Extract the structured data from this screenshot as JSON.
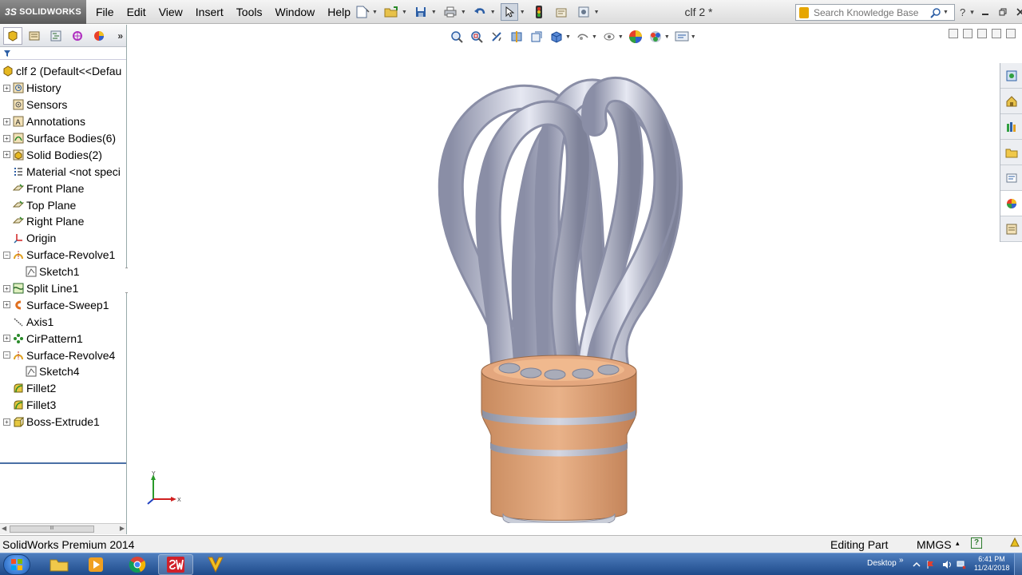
{
  "app": {
    "logo_text": "SOLIDWORKS",
    "logo_prefix": "3S",
    "document_title": "clf 2 *"
  },
  "menu": [
    "File",
    "Edit",
    "View",
    "Insert",
    "Tools",
    "Window",
    "Help"
  ],
  "search": {
    "placeholder": "Search Knowledge Base"
  },
  "title_right": {
    "help": "?",
    "dropdown": "▾"
  },
  "feature_manager": {
    "expand_label": "»",
    "root_label": "clf 2  (Default<<Defau",
    "items": [
      {
        "label": "History",
        "icon": "history-icon",
        "expandable": true
      },
      {
        "label": "Sensors",
        "icon": "sensors-icon",
        "expandable": false
      },
      {
        "label": "Annotations",
        "icon": "annotations-icon",
        "expandable": true
      },
      {
        "label": "Surface Bodies(6)",
        "icon": "surface-bodies-icon",
        "expandable": true
      },
      {
        "label": "Solid Bodies(2)",
        "icon": "solid-bodies-icon",
        "expandable": true
      },
      {
        "label": "Material <not speci",
        "icon": "material-icon",
        "expandable": false
      },
      {
        "label": "Front Plane",
        "icon": "plane-icon",
        "expandable": false
      },
      {
        "label": "Top Plane",
        "icon": "plane-icon",
        "expandable": false
      },
      {
        "label": "Right Plane",
        "icon": "plane-icon",
        "expandable": false
      },
      {
        "label": "Origin",
        "icon": "origin-icon",
        "expandable": false
      },
      {
        "label": "Surface-Revolve1",
        "icon": "surface-revolve-icon",
        "expandable": true,
        "expanded": true
      },
      {
        "label": "Sketch1",
        "icon": "sketch-icon",
        "expandable": false,
        "child": true
      },
      {
        "label": "Split Line1",
        "icon": "split-line-icon",
        "expandable": true
      },
      {
        "label": "Surface-Sweep1",
        "icon": "surface-sweep-icon",
        "expandable": true
      },
      {
        "label": "Axis1",
        "icon": "axis-icon",
        "expandable": false
      },
      {
        "label": "CirPattern1",
        "icon": "circular-pattern-icon",
        "expandable": true
      },
      {
        "label": "Surface-Revolve4",
        "icon": "surface-revolve-icon",
        "expandable": true,
        "expanded": true
      },
      {
        "label": "Sketch4",
        "icon": "sketch-icon",
        "expandable": false,
        "child": true
      },
      {
        "label": "Fillet2",
        "icon": "fillet-icon",
        "expandable": false
      },
      {
        "label": "Fillet3",
        "icon": "fillet-icon",
        "expandable": false
      },
      {
        "label": "Boss-Extrude1",
        "icon": "boss-extrude-icon",
        "expandable": true
      }
    ],
    "scroll_grip": "III"
  },
  "triad": {
    "x_label": "X",
    "y_label": "Y"
  },
  "status": {
    "product": "SolidWorks Premium 2014",
    "mode": "Editing Part",
    "units": "MMGS",
    "units_dropdown": "▴",
    "help": "?"
  },
  "taskbar": {
    "desktop_label": "Desktop",
    "chevron": "»",
    "time": "6:41 PM",
    "date": "11/24/2018"
  },
  "colors": {
    "tube": "#b9bdd2",
    "base": "#e4a77e",
    "band": "#a9acb9"
  }
}
